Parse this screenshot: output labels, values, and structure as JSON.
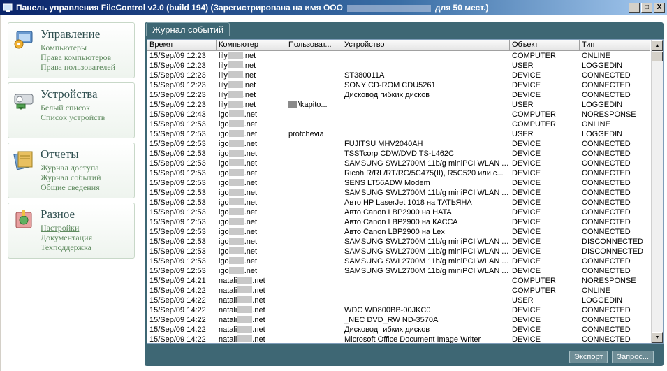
{
  "window": {
    "title_prefix": "Панель управления FileControl v2.0 (build 194) (Зарегистрирована на имя ООО",
    "title_suffix": "для 50 мест.)",
    "minimize": "_",
    "maximize": "□",
    "close": "X"
  },
  "sidebar": {
    "panels": [
      {
        "title": "Управление",
        "links": [
          "Компьютеры",
          "Права компьютеров",
          "Права пользователей"
        ]
      },
      {
        "title": "Устройства",
        "links": [
          "Белый список",
          "Список устройств"
        ]
      },
      {
        "title": "Отчеты",
        "links": [
          "Журнал доступа",
          "Журнал событий",
          "Общие сведения"
        ]
      },
      {
        "title": "Разное",
        "links": [
          "Настройки",
          "Документация",
          "Техподдержка"
        ]
      }
    ]
  },
  "main": {
    "tab_label": "Журнал событий",
    "columns": [
      "Время",
      "Компьютер",
      "Пользоват...",
      "Устройство",
      "Объект",
      "Тип"
    ],
    "rows": [
      [
        "15/Sep/09 12:23",
        "lily",
        ".net",
        "",
        "",
        "COMPUTER",
        "ONLINE"
      ],
      [
        "15/Sep/09 12:23",
        "lily",
        ".net",
        "",
        "",
        "USER",
        "LOGGEDIN"
      ],
      [
        "15/Sep/09 12:23",
        "lily",
        ".net",
        "",
        "ST380011A",
        "DEVICE",
        "CONNECTED"
      ],
      [
        "15/Sep/09 12:23",
        "lily",
        ".net",
        "",
        "SONY CD-ROM CDU5261",
        "DEVICE",
        "CONNECTED"
      ],
      [
        "15/Sep/09 12:23",
        "lily",
        ".net",
        "",
        "Дисковод гибких дисков",
        "DEVICE",
        "CONNECTED"
      ],
      [
        "15/Sep/09 12:23",
        "lily",
        ".net",
        "\\kapito...",
        "",
        "USER",
        "LOGGEDIN"
      ],
      [
        "15/Sep/09 12:43",
        "igo",
        ".net",
        "",
        "",
        "COMPUTER",
        "NORESPONSE"
      ],
      [
        "15/Sep/09 12:53",
        "igo",
        ".net",
        "",
        "",
        "COMPUTER",
        "ONLINE"
      ],
      [
        "15/Sep/09 12:53",
        "igo",
        ".net",
        "protchevia",
        "",
        "USER",
        "LOGGEDIN"
      ],
      [
        "15/Sep/09 12:53",
        "igo",
        ".net",
        "",
        "FUJITSU MHV2040AH",
        "DEVICE",
        "CONNECTED"
      ],
      [
        "15/Sep/09 12:53",
        "igo",
        ".net",
        "",
        "TSSTcorp CDW/DVD TS-L462C",
        "DEVICE",
        "CONNECTED"
      ],
      [
        "15/Sep/09 12:53",
        "igo",
        ".net",
        "",
        "SAMSUNG SWL2700M 11b/g miniPCI WLAN A...",
        "DEVICE",
        "CONNECTED"
      ],
      [
        "15/Sep/09 12:53",
        "igo",
        ".net",
        "",
        "Ricoh R/RL/RT/RC/5C475(II), R5C520 или с...",
        "DEVICE",
        "CONNECTED"
      ],
      [
        "15/Sep/09 12:53",
        "igo",
        ".net",
        "",
        "SENS LT56ADW Modem",
        "DEVICE",
        "CONNECTED"
      ],
      [
        "15/Sep/09 12:53",
        "igo",
        ".net",
        "",
        "SAMSUNG SWL2700M 11b/g miniPCI WLAN A...",
        "DEVICE",
        "CONNECTED"
      ],
      [
        "15/Sep/09 12:53",
        "igo",
        ".net",
        "",
        "Авто HP LaserJet 1018 на ТАТЬЯНА",
        "DEVICE",
        "CONNECTED"
      ],
      [
        "15/Sep/09 12:53",
        "igo",
        ".net",
        "",
        "Авто Canon LBP2900 на HATA",
        "DEVICE",
        "CONNECTED"
      ],
      [
        "15/Sep/09 12:53",
        "igo",
        ".net",
        "",
        "Авто Canon LBP2900 на КАССА",
        "DEVICE",
        "CONNECTED"
      ],
      [
        "15/Sep/09 12:53",
        "igo",
        ".net",
        "",
        "Авто Canon LBP2900 на Lex",
        "DEVICE",
        "CONNECTED"
      ],
      [
        "15/Sep/09 12:53",
        "igo",
        ".net",
        "",
        "SAMSUNG SWL2700M 11b/g miniPCI WLAN A...",
        "DEVICE",
        "DISCONNECTED"
      ],
      [
        "15/Sep/09 12:53",
        "igo",
        ".net",
        "",
        "SAMSUNG SWL2700M 11b/g miniPCI WLAN A...",
        "DEVICE",
        "DISCONNECTED"
      ],
      [
        "15/Sep/09 12:53",
        "igo",
        ".net",
        "",
        "SAMSUNG SWL2700M 11b/g miniPCI WLAN A...",
        "DEVICE",
        "CONNECTED"
      ],
      [
        "15/Sep/09 12:53",
        "igo",
        ".net",
        "",
        "SAMSUNG SWL2700M 11b/g miniPCI WLAN A...",
        "DEVICE",
        "CONNECTED"
      ],
      [
        "15/Sep/09 14:21",
        "natali",
        ".net",
        "",
        "",
        "COMPUTER",
        "NORESPONSE"
      ],
      [
        "15/Sep/09 14:22",
        "natali",
        ".net",
        "",
        "",
        "COMPUTER",
        "ONLINE"
      ],
      [
        "15/Sep/09 14:22",
        "natali",
        ".net",
        "",
        "",
        "USER",
        "LOGGEDIN"
      ],
      [
        "15/Sep/09 14:22",
        "natali",
        ".net",
        "",
        "WDC WD800BB-00JKC0",
        "DEVICE",
        "CONNECTED"
      ],
      [
        "15/Sep/09 14:22",
        "natali",
        ".net",
        "",
        "_NEC DVD_RW ND-3570A",
        "DEVICE",
        "CONNECTED"
      ],
      [
        "15/Sep/09 14:22",
        "natali",
        ".net",
        "",
        "Дисковод гибких дисков",
        "DEVICE",
        "CONNECTED"
      ],
      [
        "15/Sep/09 14:22",
        "natali",
        ".net",
        "",
        "Microsoft Office Document Image Writer",
        "DEVICE",
        "CONNECTED"
      ]
    ],
    "buttons": {
      "export": "Экспорт",
      "query": "Запрос..."
    }
  },
  "colors": {
    "content_bg": "#3e6774",
    "link": "#5f8a5f",
    "title_bar": "#0a246a"
  }
}
